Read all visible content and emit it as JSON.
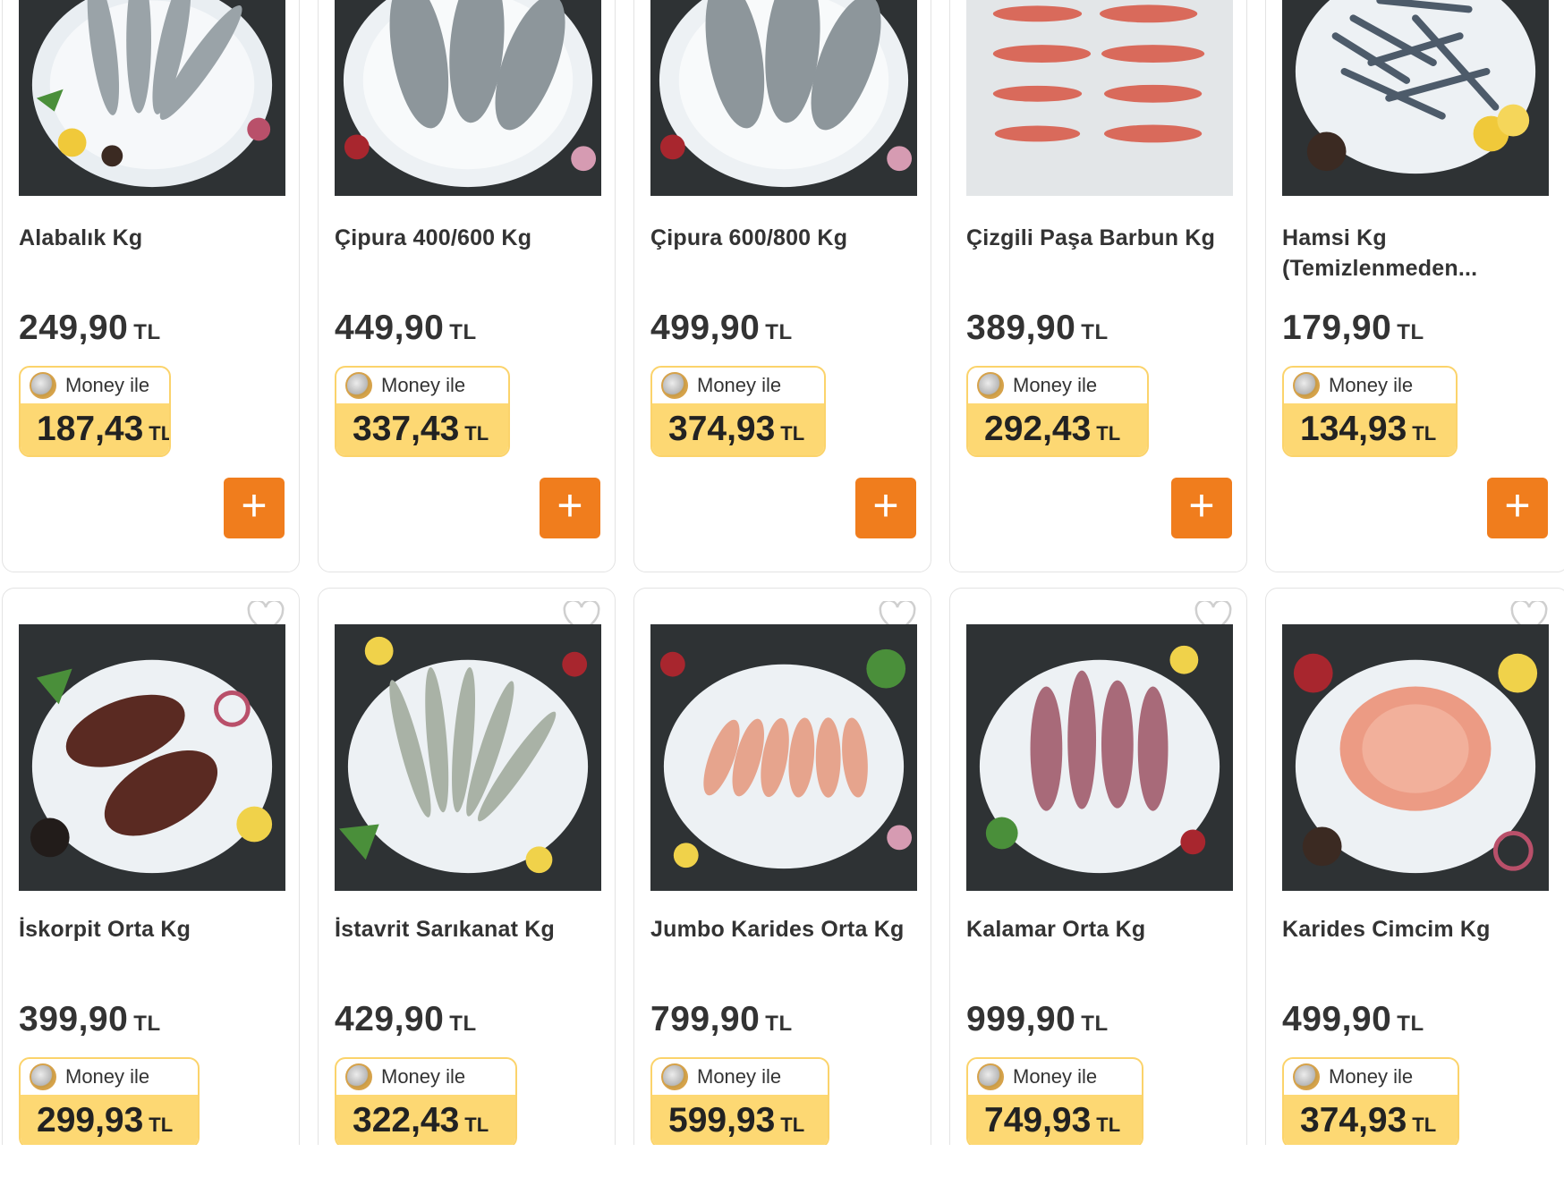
{
  "currency": "TL",
  "money_label": "Money ile",
  "add_symbol": "+",
  "products": [
    {
      "name": "Alabalık Kg",
      "price": "249,90",
      "money_price": "187,43",
      "image": "trout-on-ice-image"
    },
    {
      "name": "Çipura 400/600 Kg",
      "price": "449,90",
      "money_price": "337,43",
      "image": "sea-bream-on-ice-image"
    },
    {
      "name": "Çipura 600/800 Kg",
      "price": "499,90",
      "money_price": "374,93",
      "image": "sea-bream-on-ice-image"
    },
    {
      "name": "Çizgili Paşa Barbun Kg",
      "price": "389,90",
      "money_price": "292,43",
      "image": "red-mullet-on-ice-image"
    },
    {
      "name": "Hamsi Kg (Temizlenmeden...",
      "price": "179,90",
      "money_price": "134,93",
      "image": "anchovy-on-ice-image"
    },
    {
      "name": "İskorpit Orta Kg",
      "price": "399,90",
      "money_price": "299,93",
      "image": "scorpionfish-on-ice-image"
    },
    {
      "name": "İstavrit Sarıkanat Kg",
      "price": "429,90",
      "money_price": "322,43",
      "image": "horse-mackerel-on-ice-image"
    },
    {
      "name": "Jumbo Karides Orta Kg",
      "price": "799,90",
      "money_price": "599,93",
      "image": "jumbo-shrimp-on-ice-image"
    },
    {
      "name": "Kalamar Orta Kg",
      "price": "999,90",
      "money_price": "749,93",
      "image": "squid-on-ice-image"
    },
    {
      "name": "Karides Cimcim Kg",
      "price": "499,90",
      "money_price": "374,93",
      "image": "small-shrimp-on-ice-image"
    }
  ],
  "colors": {
    "accent": "#f07d1d",
    "money_bg": "#fdd873",
    "money_border": "#fbd36b",
    "card_border": "#e3e3e3"
  }
}
